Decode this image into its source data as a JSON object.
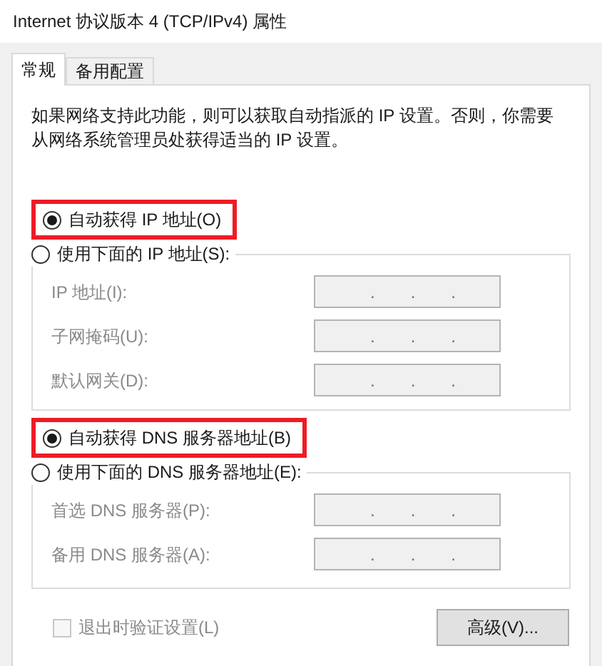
{
  "window": {
    "title": "Internet 协议版本 4 (TCP/IPv4) 属性"
  },
  "tabs": [
    {
      "label": "常规",
      "selected": true
    },
    {
      "label": "备用配置",
      "selected": false
    }
  ],
  "description": "如果网络支持此功能，则可以获取自动指派的 IP 设置。否则，你需要从网络系统管理员处获得适当的 IP 设置。",
  "sections": [
    {
      "options": [
        {
          "label": "自动获得 IP 地址(O)",
          "selected": true,
          "highlighted": true
        },
        {
          "label": "使用下面的 IP 地址(S):",
          "selected": false
        }
      ],
      "fields": [
        {
          "label": "IP 地址(I):",
          "disabled": true,
          "separator": "."
        },
        {
          "label": "子网掩码(U):",
          "disabled": true,
          "separator": "."
        },
        {
          "label": "默认网关(D):",
          "disabled": true,
          "separator": "."
        }
      ]
    },
    {
      "options": [
        {
          "label": "自动获得 DNS 服务器地址(B)",
          "selected": true,
          "highlighted": true
        },
        {
          "label": "使用下面的 DNS 服务器地址(E):",
          "selected": false
        }
      ],
      "fields": [
        {
          "label": "首选 DNS 服务器(P):",
          "disabled": true,
          "separator": "."
        },
        {
          "label": "备用 DNS 服务器(A):",
          "disabled": true,
          "separator": "."
        }
      ]
    }
  ],
  "validate_checkbox": {
    "label": "退出时验证设置(L)",
    "checked": false,
    "disabled": true
  },
  "advanced_button": {
    "label": "高级(V)..."
  }
}
